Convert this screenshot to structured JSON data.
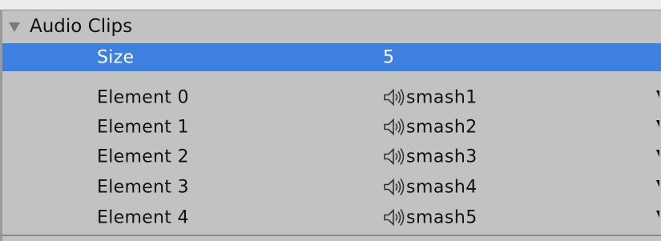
{
  "section": {
    "title": "Audio Clips",
    "expanded": true
  },
  "size": {
    "label": "Size",
    "value": "5"
  },
  "elements": [
    {
      "label": "Element 0",
      "clip": "smash1",
      "icon": "speaker-icon"
    },
    {
      "label": "Element 1",
      "clip": "smash2",
      "icon": "speaker-icon"
    },
    {
      "label": "Element 2",
      "clip": "smash3",
      "icon": "speaker-icon"
    },
    {
      "label": "Element 3",
      "clip": "smash4",
      "icon": "speaker-icon"
    },
    {
      "label": "Element 4",
      "clip": "smash5",
      "icon": "speaker-icon"
    }
  ],
  "colors": {
    "panel_bg": "#c2c2c2",
    "selection": "#3d80df",
    "text": "#111111",
    "selected_text": "#ffffff"
  }
}
